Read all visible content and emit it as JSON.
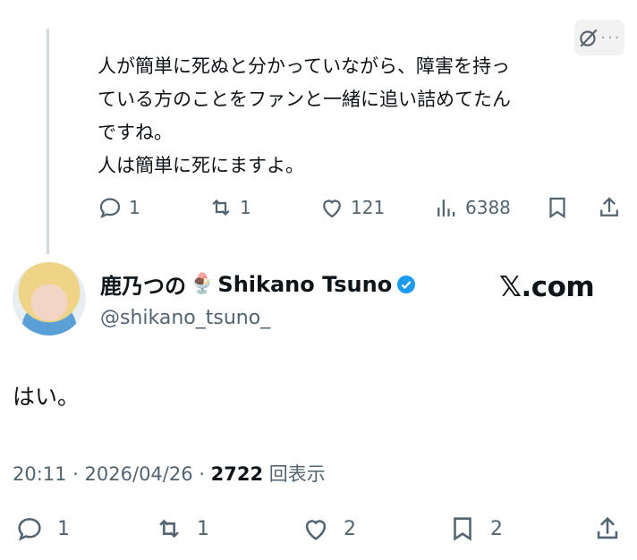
{
  "reply": {
    "text": "人が簡単に死ぬと分かっていながら、障害を持っ\nている方のことをファンと一緒に追い詰めてたん\nですね。\n人は簡単に死にますよ。",
    "actions": {
      "replies": "1",
      "reposts": "1",
      "likes": "121",
      "views": "6388"
    }
  },
  "tweet": {
    "author_name": "鹿乃つの",
    "author_name_suffix": "Shikano Tsuno",
    "handle": "@shikano_tsuno_",
    "source": "𝕏.com",
    "text": "はい。",
    "time": "20:11 · 2026/04/26 · ",
    "views_count": "2722",
    "views_label": " 回表示",
    "actions": {
      "replies": "1",
      "reposts": "1",
      "likes": "2",
      "bookmarks": "2"
    }
  },
  "top": {
    "more": "···"
  },
  "colors": {
    "muted": "#536471",
    "text": "#0f1419",
    "verified": "#1d9bf0"
  },
  "icons": [
    "reply-icon",
    "repost-icon",
    "like-icon",
    "views-icon",
    "bookmark-icon",
    "share-icon",
    "verified-badge-icon",
    "mute-icon"
  ]
}
